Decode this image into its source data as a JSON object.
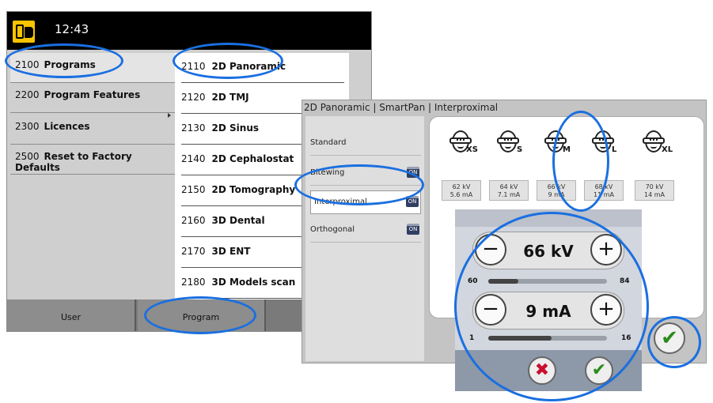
{
  "status_bar": {
    "time": "12:43",
    "logo_icon": "dental-unit-icon"
  },
  "settings_menu": {
    "items": [
      {
        "code": "2100",
        "label": "Programs",
        "selected": true
      },
      {
        "code": "2200",
        "label": "Program Features"
      },
      {
        "code": "2300",
        "label": "Licences"
      },
      {
        "code": "2500",
        "label": "Reset to Factory Defaults"
      }
    ]
  },
  "programs_list": {
    "items": [
      {
        "code": "2110",
        "label": "2D Panoramic"
      },
      {
        "code": "2120",
        "label": "2D TMJ"
      },
      {
        "code": "2130",
        "label": "2D Sinus"
      },
      {
        "code": "2140",
        "label": "2D Cephalostat"
      },
      {
        "code": "2150",
        "label": "2D Tomography"
      },
      {
        "code": "2160",
        "label": "3D Dental"
      },
      {
        "code": "2170",
        "label": "3D ENT"
      },
      {
        "code": "2180",
        "label": "3D Models scan"
      }
    ]
  },
  "bottom_tabs": [
    {
      "label": "User"
    },
    {
      "label": "Program"
    }
  ],
  "dialog": {
    "title": "2D Panoramic | SmartPan | Interproximal",
    "modes": [
      {
        "label": "Standard",
        "toggle": ""
      },
      {
        "label": "Bitewing",
        "toggle": "ON"
      },
      {
        "label": "Interproximal",
        "toggle": "ON",
        "selected": true
      },
      {
        "label": "Orthogonal",
        "toggle": "ON"
      }
    ],
    "patient_sizes": [
      {
        "size": "XS",
        "kv": "62 kV",
        "ma": "5.6 mA"
      },
      {
        "size": "S",
        "kv": "64 kV",
        "ma": "7.1 mA"
      },
      {
        "size": "M",
        "kv": "66 kV",
        "ma": "9 mA",
        "selected": true
      },
      {
        "size": "L",
        "kv": "68 kV",
        "ma": "11 mA"
      },
      {
        "size": "XL",
        "kv": "70 kV",
        "ma": "14 mA"
      }
    ],
    "kv_control": {
      "value": "66 kV",
      "min": "60",
      "max": "84",
      "fraction": 0.25,
      "minus": "−",
      "plus": "+"
    },
    "ma_control": {
      "value": "9 mA",
      "min": "1",
      "max": "16",
      "fraction": 0.53,
      "minus": "−",
      "plus": "+"
    },
    "cancel_symbol": "✖",
    "confirm_symbol": "✔"
  },
  "colors": {
    "highlight": "#1a6fe0",
    "toggle": "#2f3e62",
    "confirm_green": "#2a8a1c",
    "cancel_red": "#c8102e"
  }
}
